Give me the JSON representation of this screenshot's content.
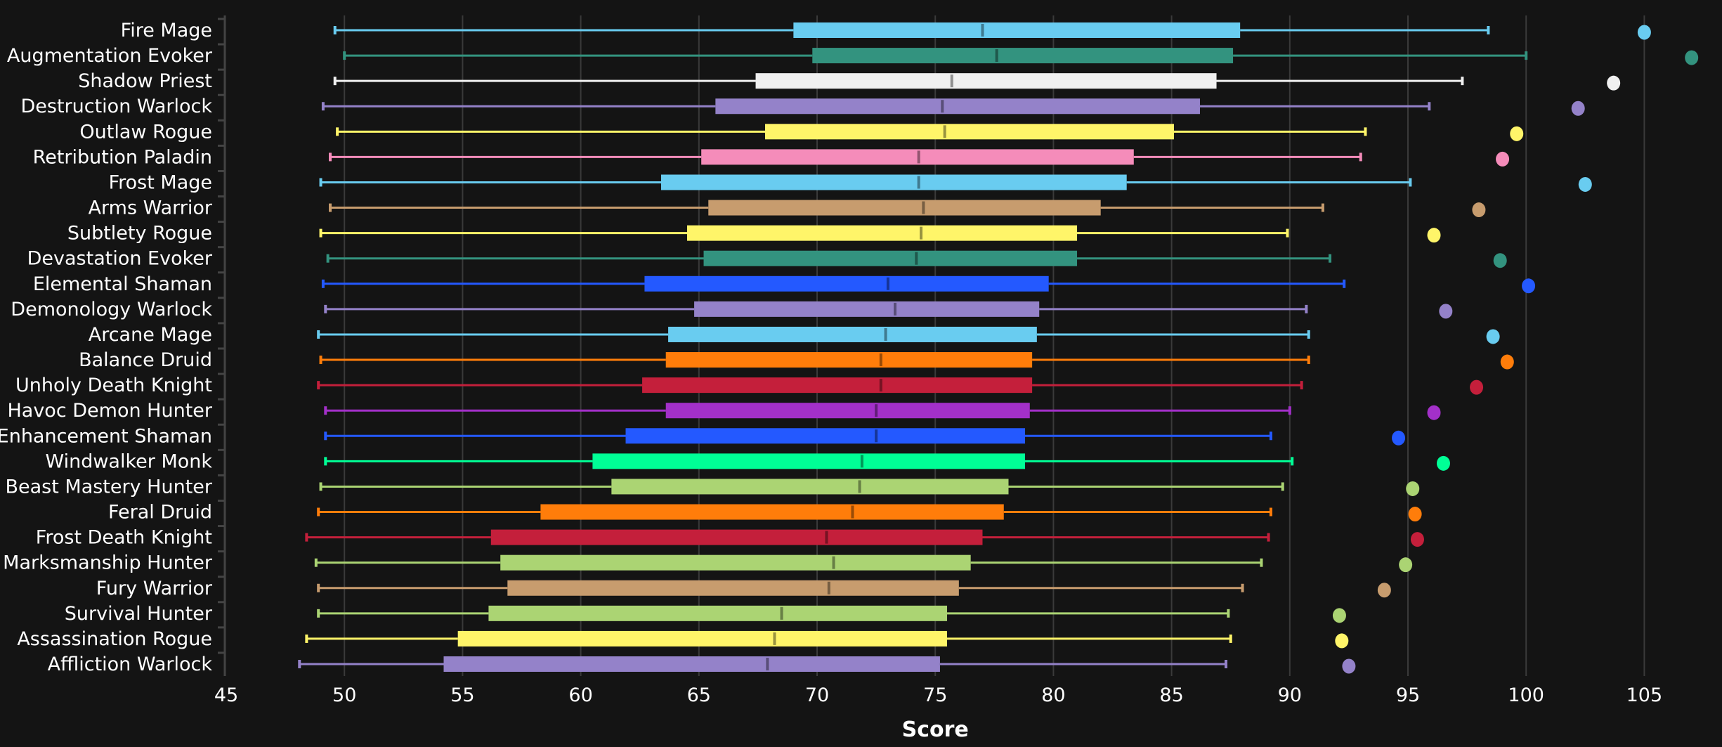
{
  "chart_data": {
    "type": "boxplot",
    "title": "",
    "xlabel": "Score",
    "ylabel": "",
    "xlim": [
      45,
      108
    ],
    "xticks": [
      45,
      50,
      55,
      60,
      65,
      70,
      75,
      80,
      85,
      90,
      95,
      100,
      105
    ],
    "grid": "vertical",
    "legend": "none",
    "background": "#141414",
    "series": [
      {
        "name": "Fire Mage",
        "color": "#69CCF0",
        "whisker_low": 49.6,
        "q1": 69.0,
        "median": 77.0,
        "q3": 87.9,
        "whisker_high": 98.4,
        "outlier": 105.0
      },
      {
        "name": "Augmentation Evoker",
        "color": "#33937F",
        "whisker_low": 50.0,
        "q1": 69.8,
        "median": 77.6,
        "q3": 87.6,
        "whisker_high": 100.0,
        "outlier": 107.0
      },
      {
        "name": "Shadow Priest",
        "color": "#F0F0F0",
        "whisker_low": 49.6,
        "q1": 67.4,
        "median": 75.7,
        "q3": 86.9,
        "whisker_high": 97.3,
        "outlier": 103.7
      },
      {
        "name": "Destruction Warlock",
        "color": "#9482C9",
        "whisker_low": 49.1,
        "q1": 65.7,
        "median": 75.3,
        "q3": 86.2,
        "whisker_high": 95.9,
        "outlier": 102.2
      },
      {
        "name": "Outlaw Rogue",
        "color": "#FFF569",
        "whisker_low": 49.7,
        "q1": 67.8,
        "median": 75.4,
        "q3": 85.1,
        "whisker_high": 93.2,
        "outlier": 99.6
      },
      {
        "name": "Retribution Paladin",
        "color": "#F58CBA",
        "whisker_low": 49.4,
        "q1": 65.1,
        "median": 74.3,
        "q3": 83.4,
        "whisker_high": 93.0,
        "outlier": 99.0
      },
      {
        "name": "Frost Mage",
        "color": "#69CCF0",
        "whisker_low": 49.0,
        "q1": 63.4,
        "median": 74.3,
        "q3": 83.1,
        "whisker_high": 95.1,
        "outlier": 102.5
      },
      {
        "name": "Arms Warrior",
        "color": "#C79C6E",
        "whisker_low": 49.4,
        "q1": 65.4,
        "median": 74.5,
        "q3": 82.0,
        "whisker_high": 91.4,
        "outlier": 98.0
      },
      {
        "name": "Subtlety Rogue",
        "color": "#FFF569",
        "whisker_low": 49.0,
        "q1": 64.5,
        "median": 74.4,
        "q3": 81.0,
        "whisker_high": 89.9,
        "outlier": 96.1
      },
      {
        "name": "Devastation Evoker",
        "color": "#33937F",
        "whisker_low": 49.3,
        "q1": 65.2,
        "median": 74.2,
        "q3": 81.0,
        "whisker_high": 91.7,
        "outlier": 98.9
      },
      {
        "name": "Elemental Shaman",
        "color": "#2459FF",
        "whisker_low": 49.1,
        "q1": 62.7,
        "median": 73.0,
        "q3": 79.8,
        "whisker_high": 92.3,
        "outlier": 100.1
      },
      {
        "name": "Demonology Warlock",
        "color": "#9482C9",
        "whisker_low": 49.2,
        "q1": 64.8,
        "median": 73.3,
        "q3": 79.4,
        "whisker_high": 90.7,
        "outlier": 96.6
      },
      {
        "name": "Arcane Mage",
        "color": "#69CCF0",
        "whisker_low": 48.9,
        "q1": 63.7,
        "median": 72.9,
        "q3": 79.3,
        "whisker_high": 90.8,
        "outlier": 98.6
      },
      {
        "name": "Balance Druid",
        "color": "#FF7D0A",
        "whisker_low": 49.0,
        "q1": 63.6,
        "median": 72.7,
        "q3": 79.1,
        "whisker_high": 90.8,
        "outlier": 99.2
      },
      {
        "name": "Unholy Death Knight",
        "color": "#C41F3B",
        "whisker_low": 48.9,
        "q1": 62.6,
        "median": 72.7,
        "q3": 79.1,
        "whisker_high": 90.5,
        "outlier": 97.9
      },
      {
        "name": "Havoc Demon Hunter",
        "color": "#A330C9",
        "whisker_low": 49.2,
        "q1": 63.6,
        "median": 72.5,
        "q3": 79.0,
        "whisker_high": 90.0,
        "outlier": 96.1
      },
      {
        "name": "Enhancement Shaman",
        "color": "#2459FF",
        "whisker_low": 49.2,
        "q1": 61.9,
        "median": 72.5,
        "q3": 78.8,
        "whisker_high": 89.2,
        "outlier": 94.6
      },
      {
        "name": "Windwalker Monk",
        "color": "#00FF96",
        "whisker_low": 49.2,
        "q1": 60.5,
        "median": 71.9,
        "q3": 78.8,
        "whisker_high": 90.1,
        "outlier": 96.5
      },
      {
        "name": "Beast Mastery Hunter",
        "color": "#ABD473",
        "whisker_low": 49.0,
        "q1": 61.3,
        "median": 71.8,
        "q3": 78.1,
        "whisker_high": 89.7,
        "outlier": 95.2
      },
      {
        "name": "Feral Druid",
        "color": "#FF7D0A",
        "whisker_low": 48.9,
        "q1": 58.3,
        "median": 71.5,
        "q3": 77.9,
        "whisker_high": 89.2,
        "outlier": 95.3
      },
      {
        "name": "Frost Death Knight",
        "color": "#C41F3B",
        "whisker_low": 48.4,
        "q1": 56.2,
        "median": 70.4,
        "q3": 77.0,
        "whisker_high": 89.1,
        "outlier": 95.4
      },
      {
        "name": "Marksmanship Hunter",
        "color": "#ABD473",
        "whisker_low": 48.8,
        "q1": 56.6,
        "median": 70.7,
        "q3": 76.5,
        "whisker_high": 88.8,
        "outlier": 94.9
      },
      {
        "name": "Fury Warrior",
        "color": "#C79C6E",
        "whisker_low": 48.9,
        "q1": 56.9,
        "median": 70.5,
        "q3": 76.0,
        "whisker_high": 88.0,
        "outlier": 94.0
      },
      {
        "name": "Survival Hunter",
        "color": "#ABD473",
        "whisker_low": 48.9,
        "q1": 56.1,
        "median": 68.5,
        "q3": 75.5,
        "whisker_high": 87.4,
        "outlier": 92.1
      },
      {
        "name": "Assassination Rogue",
        "color": "#FFF569",
        "whisker_low": 48.4,
        "q1": 54.8,
        "median": 68.2,
        "q3": 75.5,
        "whisker_high": 87.5,
        "outlier": 92.2
      },
      {
        "name": "Affliction Warlock",
        "color": "#9482C9",
        "whisker_low": 48.1,
        "q1": 54.2,
        "median": 67.9,
        "q3": 75.2,
        "whisker_high": 87.3,
        "outlier": 92.5
      }
    ]
  }
}
